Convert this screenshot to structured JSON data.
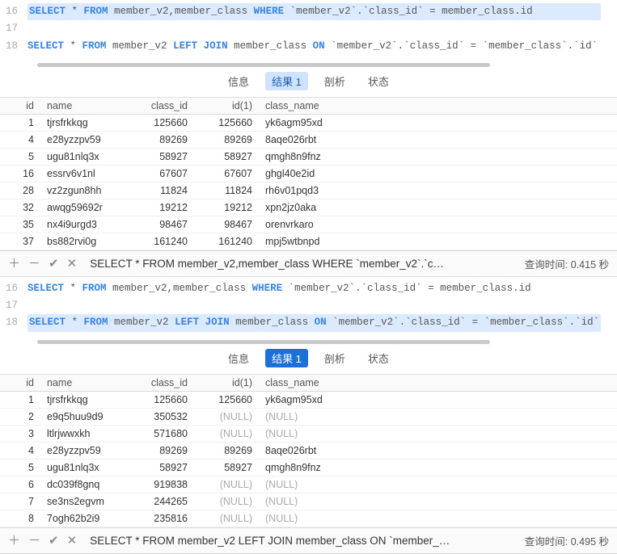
{
  "panel1": {
    "editor": {
      "lines": [
        {
          "num": "16",
          "highlight": true,
          "tokens": [
            [
              "SELECT",
              "kw"
            ],
            [
              " * ",
              "tk-gray"
            ],
            [
              "FROM",
              "kw"
            ],
            [
              " member_v2,member_class ",
              "tk-gray"
            ],
            [
              "WHERE",
              "kw"
            ],
            [
              " `member_v2`.`class_id` = member_class.id",
              "tk-gray"
            ]
          ]
        },
        {
          "num": "17",
          "highlight": false,
          "tokens": []
        },
        {
          "num": "18",
          "highlight": false,
          "tokens": [
            [
              "SELECT",
              "kw"
            ],
            [
              " * ",
              "tk-gray"
            ],
            [
              "FROM",
              "kw"
            ],
            [
              " member_v2 ",
              "tk-gray"
            ],
            [
              "LEFT JOIN",
              "kw"
            ],
            [
              " member_class ",
              "tk-gray"
            ],
            [
              "ON",
              "kw"
            ],
            [
              " `member_v2`.`class_id` = `member_class`.`id`",
              "tk-gray"
            ]
          ]
        }
      ]
    },
    "tabs": {
      "info": "信息",
      "result": "结果 1",
      "profile": "剖析",
      "status": "状态",
      "active_style": "light"
    },
    "table": {
      "headers": {
        "id": "id",
        "name": "name",
        "class_id": "class_id",
        "id1": "id(1)",
        "class_name": "class_name"
      },
      "rows": [
        {
          "id": "1",
          "name": "tjrsfrkkqg",
          "class_id": "125660",
          "id1": "125660",
          "class_name": "yk6agm95xd"
        },
        {
          "id": "4",
          "name": "e28yzzpv59",
          "class_id": "89269",
          "id1": "89269",
          "class_name": "8aqe026rbt"
        },
        {
          "id": "5",
          "name": "ugu81nlq3x",
          "class_id": "58927",
          "id1": "58927",
          "class_name": "qmgh8n9fnz"
        },
        {
          "id": "16",
          "name": "essrv6v1nl",
          "class_id": "67607",
          "id1": "67607",
          "class_name": "ghgl40e2id"
        },
        {
          "id": "28",
          "name": "vz2zgun8hh",
          "class_id": "11824",
          "id1": "11824",
          "class_name": "rh6v01pqd3"
        },
        {
          "id": "32",
          "name": "awqg59692r",
          "class_id": "19212",
          "id1": "19212",
          "class_name": "xpn2jz0aka"
        },
        {
          "id": "35",
          "name": "nx4i9urgd3",
          "class_id": "98467",
          "id1": "98467",
          "class_name": "orenvrkaro"
        },
        {
          "id": "37",
          "name": "bs882rvi0g",
          "class_id": "161240",
          "id1": "161240",
          "class_name": "mpj5wtbnpd"
        }
      ]
    },
    "footer": {
      "sql": "SELECT * FROM member_v2,member_class WHERE `member_v2`.`c…",
      "time_label": "查询时间:",
      "time_value": "0.415 秒"
    }
  },
  "panel2": {
    "editor": {
      "lines": [
        {
          "num": "16",
          "highlight": false,
          "tokens": [
            [
              "SELECT",
              "kw"
            ],
            [
              " * ",
              "tk-gray"
            ],
            [
              "FROM",
              "kw"
            ],
            [
              " member_v2,member_class ",
              "tk-gray"
            ],
            [
              "WHERE",
              "kw"
            ],
            [
              " `member_v2`.`class_id` = member_class.id",
              "tk-gray"
            ]
          ]
        },
        {
          "num": "17",
          "highlight": false,
          "tokens": []
        },
        {
          "num": "18",
          "highlight": true,
          "tokens": [
            [
              "SELECT",
              "kw"
            ],
            [
              " * ",
              "tk-gray"
            ],
            [
              "FROM",
              "kw"
            ],
            [
              " member_v2 ",
              "tk-gray"
            ],
            [
              "LEFT JOIN",
              "kw"
            ],
            [
              " member_class ",
              "tk-gray"
            ],
            [
              "ON",
              "kw"
            ],
            [
              " `member_v2`.`class_id` = `member_class`.`id`",
              "tk-gray"
            ]
          ]
        }
      ]
    },
    "tabs": {
      "info": "信息",
      "result": "结果 1",
      "profile": "剖析",
      "status": "状态",
      "active_style": "dark"
    },
    "table": {
      "headers": {
        "id": "id",
        "name": "name",
        "class_id": "class_id",
        "id1": "id(1)",
        "class_name": "class_name"
      },
      "rows": [
        {
          "id": "1",
          "name": "tjrsfrkkqg",
          "class_id": "125660",
          "id1": "125660",
          "class_name": "yk6agm95xd"
        },
        {
          "id": "2",
          "name": "e9q5huu9d9",
          "class_id": "350532",
          "id1": "(NULL)",
          "class_name": "(NULL)"
        },
        {
          "id": "3",
          "name": "ltlrjwwxkh",
          "class_id": "571680",
          "id1": "(NULL)",
          "class_name": "(NULL)"
        },
        {
          "id": "4",
          "name": "e28yzzpv59",
          "class_id": "89269",
          "id1": "89269",
          "class_name": "8aqe026rbt"
        },
        {
          "id": "5",
          "name": "ugu81nlq3x",
          "class_id": "58927",
          "id1": "58927",
          "class_name": "qmgh8n9fnz"
        },
        {
          "id": "6",
          "name": "dc039f8gnq",
          "class_id": "919838",
          "id1": "(NULL)",
          "class_name": "(NULL)"
        },
        {
          "id": "7",
          "name": "se3ns2egvm",
          "class_id": "244265",
          "id1": "(NULL)",
          "class_name": "(NULL)"
        },
        {
          "id": "8",
          "name": "7ogh62b2i9",
          "class_id": "235816",
          "id1": "(NULL)",
          "class_name": "(NULL)"
        }
      ]
    },
    "footer": {
      "sql": "SELECT * FROM member_v2 LEFT JOIN member_class ON `member_…",
      "time_label": "查询时间:",
      "time_value": "0.495 秒"
    }
  },
  "null_text": "(NULL)"
}
